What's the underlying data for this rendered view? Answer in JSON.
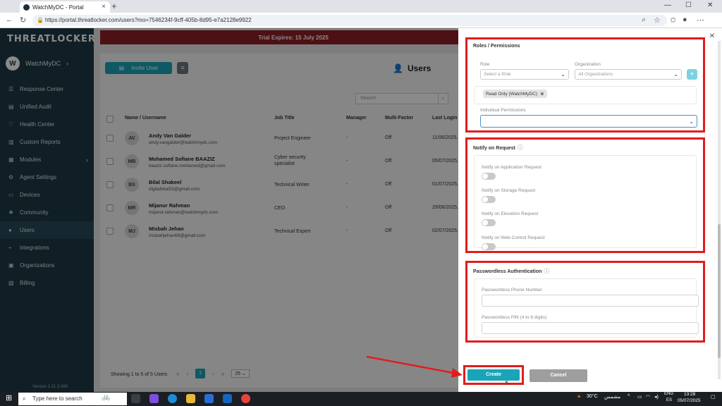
{
  "browser": {
    "tab_title": "WatchMyDC - Portal",
    "url": "https://portal.threatlocker.com/users?mo=7546234f-9cff-405b-8d95-e7a2128e9922"
  },
  "sidebar": {
    "logo": "THREATLOCKER",
    "account_initial": "W",
    "account_name": "WatchMyDC",
    "items": [
      {
        "label": "Response Center",
        "icon": "list-icon"
      },
      {
        "label": "Unified Audit",
        "icon": "document-icon"
      },
      {
        "label": "Health Center",
        "icon": "heartbeat-icon"
      },
      {
        "label": "Custom Reports",
        "icon": "report-icon"
      },
      {
        "label": "Modules",
        "icon": "grid-icon"
      },
      {
        "label": "Agent Settings",
        "icon": "settings-icon"
      },
      {
        "label": "Devices",
        "icon": "monitor-icon"
      },
      {
        "label": "Community",
        "icon": "community-icon"
      },
      {
        "label": "Users",
        "icon": "user-icon"
      },
      {
        "label": "Integrations",
        "icon": "plug-icon"
      },
      {
        "label": "Organizations",
        "icon": "building-icon"
      },
      {
        "label": "Billing",
        "icon": "billing-icon"
      }
    ],
    "version": "Version 2.21.3.499"
  },
  "banner": "Trial Expires: 15 July 2025",
  "main": {
    "invite_label": "Invite User",
    "page_title": "Users",
    "search_placeholder": "Search",
    "columns": [
      "Name / Username",
      "Job Title",
      "Manager",
      "Multi-Factor",
      "Last Login"
    ],
    "rows": [
      {
        "initials": "AV",
        "name": "Andy Van Galder",
        "email": "andy.vangalder@watchmydc.com",
        "job": "Project Engineer",
        "manager": "-",
        "mfa": "Off",
        "last_login": "11/06/2025,"
      },
      {
        "initials": "MB",
        "name": "Mohamed Sofiane BAAZIZ",
        "email": "baaziz.sofiane.mohamed@gmail.com",
        "job": "Cyber security specialist",
        "manager": "-",
        "mfa": "Off",
        "last_login": "05/07/2025,"
      },
      {
        "initials": "BS",
        "name": "Bilal  Shakeel",
        "email": "digitalbilal53@gmail.com",
        "job": "Technical Writer",
        "manager": "-",
        "mfa": "Off",
        "last_login": "01/07/2025,"
      },
      {
        "initials": "MR",
        "name": "Mijanur Rahman",
        "email": "mijanur.rahman@watchmydc.com",
        "job": "CEO",
        "manager": "-",
        "mfa": "Off",
        "last_login": "29/06/2025,"
      },
      {
        "initials": "MJ",
        "name": "Misbah Jehan",
        "email": "misbahjehan68@gmail.com",
        "job": "Technical Expert",
        "manager": "-",
        "mfa": "Off",
        "last_login": "02/07/2025,"
      }
    ],
    "footer": "Showing 1 to 5 of 5 Users",
    "current_page": "1",
    "page_size": "25"
  },
  "panel": {
    "roles": {
      "heading": "Roles / Permissions",
      "role_label": "Role",
      "role_placeholder": "Select a Role",
      "org_label": "Organization",
      "org_placeholder": "All Organizations",
      "chip": "Read Only (WatchMyDC)",
      "individual_label": "Individual Permissions"
    },
    "notify": {
      "heading": "Notify on Request",
      "items": [
        "Notify on Application Request",
        "Notify on Storage Request",
        "Notify on Elevation Request",
        "Notify on Web Control Request"
      ]
    },
    "passwordless": {
      "heading": "Passwordless Authentication",
      "phone_label": "Passwordless Phone Number",
      "pin_label": "Passwordless PIN (4 to 8 digits)"
    },
    "create_label": "Create",
    "cancel_label": "Cancel"
  },
  "taskbar": {
    "search_placeholder": "Type here to search",
    "weather": "30°C",
    "weather_text": "مشمس",
    "lang_top": "ENG",
    "lang_bottom": "ES",
    "time": "13:28",
    "date": "05/07/2025"
  },
  "colors": {
    "sidebar": "#1d3a45",
    "accent": "#1aa4b8",
    "banner": "#8f1e26",
    "highlight": "#e01d1d"
  }
}
